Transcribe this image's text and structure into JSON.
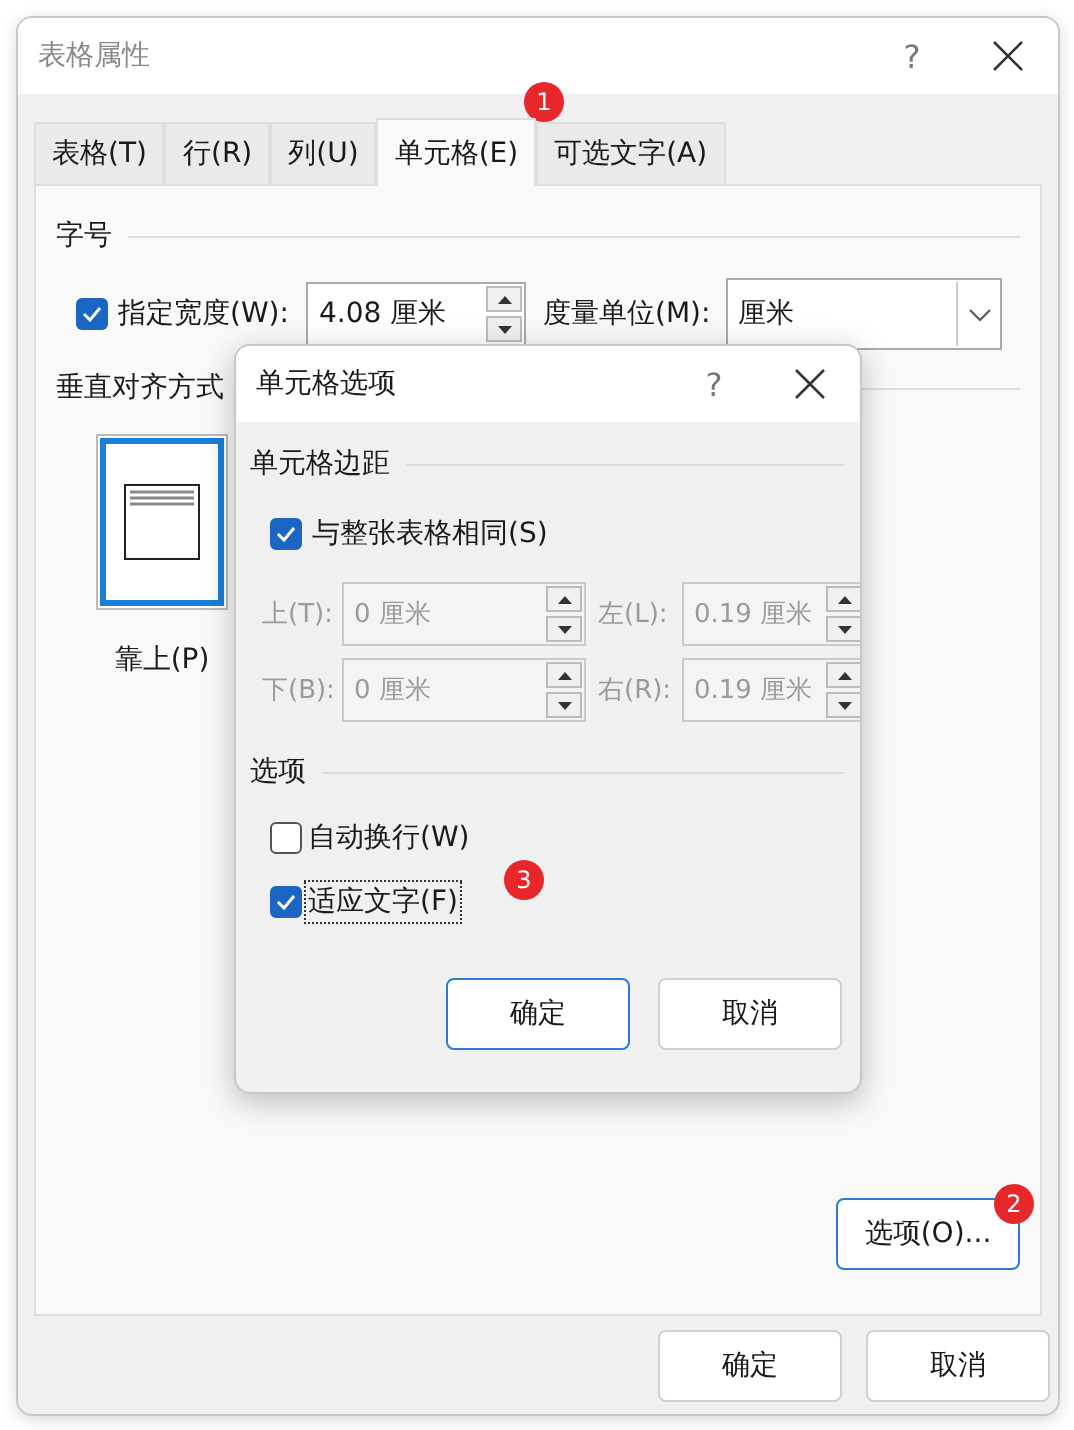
{
  "dialog": {
    "title": "表格属性",
    "help": "?"
  },
  "tabs": [
    {
      "label": "表格(T)",
      "selected": false
    },
    {
      "label": "行(R)",
      "selected": false
    },
    {
      "label": "列(U)",
      "selected": false
    },
    {
      "label": "单元格(E)",
      "selected": true
    },
    {
      "label": "可选文字(A)",
      "selected": false
    }
  ],
  "size_section": {
    "heading": "字号",
    "width_checkbox": {
      "label": "指定宽度(W):",
      "checked": true
    },
    "width_value": "4.08 厘米",
    "unit_label": "度量单位(M):",
    "unit_value": "厘米"
  },
  "valign_section": {
    "heading": "垂直对齐方式",
    "options": [
      {
        "label": "靠上(P)",
        "selected": true
      }
    ]
  },
  "options_button": "选项(O)...",
  "buttons": [
    "确定",
    "取消"
  ],
  "cell_options": {
    "title": "单元格选项",
    "help": "?",
    "margins_heading": "单元格边距",
    "same_as_table": {
      "label": "与整张表格相同(S)",
      "checked": true
    },
    "margins": [
      {
        "label": "上(T):",
        "value": "0 厘米",
        "disabled": true
      },
      {
        "label": "左(L):",
        "value": "0.19 厘米",
        "disabled": true
      },
      {
        "label": "下(B):",
        "value": "0 厘米",
        "disabled": true
      },
      {
        "label": "右(R):",
        "value": "0.19 厘米",
        "disabled": true
      }
    ],
    "options_heading": "选项",
    "options": [
      {
        "label": "自动换行(W)",
        "checked": false,
        "focused": false
      },
      {
        "label": "适应文字(F)",
        "checked": true,
        "focused": true
      }
    ],
    "buttons": [
      {
        "label": "确定",
        "default": true
      },
      {
        "label": "取消",
        "default": false
      }
    ]
  },
  "annotations": [
    "1",
    "2",
    "3"
  ]
}
